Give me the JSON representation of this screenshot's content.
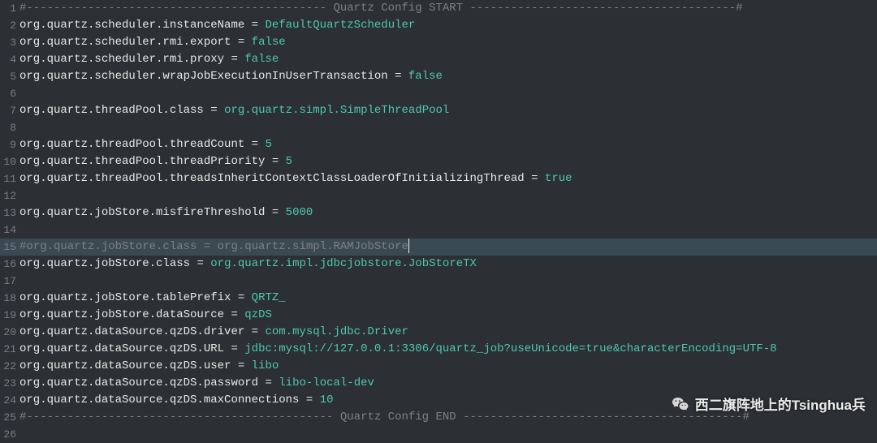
{
  "watermark": {
    "text": "西二旗阵地上的Tsinghua兵"
  },
  "lines": [
    {
      "n": 1,
      "segs": [
        {
          "t": "#-------------------------------------------- Quartz Config START ---------------------------------------#",
          "cls": "comment"
        }
      ]
    },
    {
      "n": 2,
      "segs": [
        {
          "t": "org.quartz.scheduler.instanceName",
          "cls": "prop"
        },
        {
          "t": " = ",
          "cls": "eq"
        },
        {
          "t": "DefaultQuartzScheduler",
          "cls": "val"
        }
      ]
    },
    {
      "n": 3,
      "segs": [
        {
          "t": "org.quartz.scheduler.rmi.export",
          "cls": "prop"
        },
        {
          "t": " = ",
          "cls": "eq"
        },
        {
          "t": "false",
          "cls": "val"
        }
      ]
    },
    {
      "n": 4,
      "segs": [
        {
          "t": "org.quartz.scheduler.rmi.proxy",
          "cls": "prop"
        },
        {
          "t": " = ",
          "cls": "eq"
        },
        {
          "t": "false",
          "cls": "val"
        }
      ]
    },
    {
      "n": 5,
      "segs": [
        {
          "t": "org.quartz.scheduler.wrapJobExecutionInUserTransaction",
          "cls": "prop"
        },
        {
          "t": " = ",
          "cls": "eq"
        },
        {
          "t": "false",
          "cls": "val"
        }
      ]
    },
    {
      "n": 6,
      "segs": [
        {
          "t": " ",
          "cls": "prop"
        }
      ]
    },
    {
      "n": 7,
      "segs": [
        {
          "t": "org.quartz.threadPool.class",
          "cls": "prop"
        },
        {
          "t": " = ",
          "cls": "eq"
        },
        {
          "t": "org.quartz.simpl.SimpleThreadPool",
          "cls": "val"
        }
      ]
    },
    {
      "n": 8,
      "segs": [
        {
          "t": " ",
          "cls": "prop"
        }
      ]
    },
    {
      "n": 9,
      "segs": [
        {
          "t": "org.quartz.threadPool.threadCount",
          "cls": "prop"
        },
        {
          "t": " = ",
          "cls": "eq"
        },
        {
          "t": "5",
          "cls": "valnum"
        }
      ]
    },
    {
      "n": 10,
      "segs": [
        {
          "t": "org.quartz.threadPool.threadPriority",
          "cls": "prop"
        },
        {
          "t": " = ",
          "cls": "eq"
        },
        {
          "t": "5",
          "cls": "valnum"
        }
      ]
    },
    {
      "n": 11,
      "segs": [
        {
          "t": "org.quartz.threadPool.threadsInheritContextClassLoaderOfInitializingThread",
          "cls": "prop"
        },
        {
          "t": " = ",
          "cls": "eq"
        },
        {
          "t": "true",
          "cls": "val"
        }
      ]
    },
    {
      "n": 12,
      "segs": [
        {
          "t": " ",
          "cls": "prop"
        }
      ]
    },
    {
      "n": 13,
      "segs": [
        {
          "t": "org.quartz.jobStore.misfireThreshold",
          "cls": "prop"
        },
        {
          "t": " = ",
          "cls": "eq"
        },
        {
          "t": "5000",
          "cls": "valnum"
        }
      ]
    },
    {
      "n": 14,
      "segs": [
        {
          "t": " ",
          "cls": "prop"
        }
      ]
    },
    {
      "n": 15,
      "hl": true,
      "cursor": true,
      "segs": [
        {
          "t": "#org.quartz.jobStore.class = org.quartz.simpl.RAMJobStore",
          "cls": "comment"
        }
      ]
    },
    {
      "n": 16,
      "segs": [
        {
          "t": "org.quartz.jobStore.class",
          "cls": "prop"
        },
        {
          "t": " = ",
          "cls": "eq"
        },
        {
          "t": "org.quartz.impl.jdbcjobstore.JobStoreTX",
          "cls": "val"
        }
      ]
    },
    {
      "n": 17,
      "segs": [
        {
          "t": " ",
          "cls": "prop"
        }
      ]
    },
    {
      "n": 18,
      "segs": [
        {
          "t": "org.quartz.jobStore.tablePrefix",
          "cls": "prop"
        },
        {
          "t": " = ",
          "cls": "eq"
        },
        {
          "t": "QRTZ_",
          "cls": "val"
        }
      ]
    },
    {
      "n": 19,
      "segs": [
        {
          "t": "org.quartz.jobStore.dataSource",
          "cls": "prop"
        },
        {
          "t": " = ",
          "cls": "eq"
        },
        {
          "t": "qzDS",
          "cls": "val"
        }
      ]
    },
    {
      "n": 20,
      "segs": [
        {
          "t": "org.quartz.dataSource.qzDS.driver",
          "cls": "prop"
        },
        {
          "t": " = ",
          "cls": "eq"
        },
        {
          "t": "com.mysql.jdbc.Driver",
          "cls": "val"
        }
      ]
    },
    {
      "n": 21,
      "segs": [
        {
          "t": "org.quartz.dataSource.qzDS.URL",
          "cls": "prop"
        },
        {
          "t": " = ",
          "cls": "eq"
        },
        {
          "t": "jdbc:mysql://127.0.0.1:3306/quartz_job?useUnicode=true&characterEncoding=UTF-8",
          "cls": "val"
        }
      ]
    },
    {
      "n": 22,
      "segs": [
        {
          "t": "org.quartz.dataSource.qzDS.user",
          "cls": "prop"
        },
        {
          "t": " = ",
          "cls": "eq"
        },
        {
          "t": "libo",
          "cls": "val"
        }
      ]
    },
    {
      "n": 23,
      "segs": [
        {
          "t": "org.quartz.dataSource.qzDS.password",
          "cls": "prop"
        },
        {
          "t": " = ",
          "cls": "eq"
        },
        {
          "t": "libo-local-dev",
          "cls": "val"
        }
      ]
    },
    {
      "n": 24,
      "segs": [
        {
          "t": "org.quartz.dataSource.qzDS.maxConnections",
          "cls": "prop"
        },
        {
          "t": " = ",
          "cls": "eq"
        },
        {
          "t": "10",
          "cls": "valnum"
        }
      ]
    },
    {
      "n": 25,
      "segs": [
        {
          "t": "#--------------------------------------------- Quartz Config END -----------------------------------------#",
          "cls": "comment"
        }
      ]
    },
    {
      "n": 26,
      "segs": [
        {
          "t": " ",
          "cls": "prop"
        }
      ]
    }
  ]
}
